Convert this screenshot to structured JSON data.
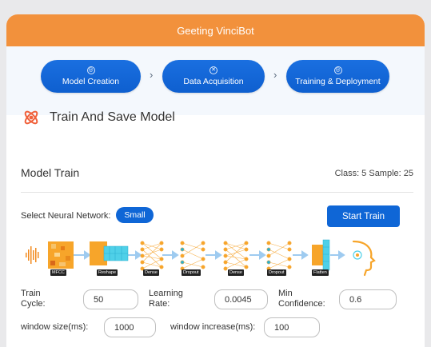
{
  "header": {
    "title": "Geeting VinciBot"
  },
  "steps": [
    {
      "label": "Model Creation"
    },
    {
      "label": "Data Acquisition"
    },
    {
      "label": "Training & Deployment"
    }
  ],
  "section": {
    "title": "Train And Save Model"
  },
  "model_train": {
    "title": "Model Train",
    "class_sample": "Class: 5 Sample: 25",
    "select_label": "Select Neural Network:",
    "network_value": "Small",
    "start_button": "Start Train"
  },
  "pipeline": {
    "layers": [
      "MFCC",
      "Reshape",
      "Dense",
      "Dropout",
      "Dense",
      "Dropout",
      "Flatten"
    ]
  },
  "params": {
    "train_cycle_label_1": "Train",
    "train_cycle_label_2": "Cycle:",
    "train_cycle_value": "50",
    "learning_rate_label_1": "Learning",
    "learning_rate_label_2": "Rate:",
    "learning_rate_value": "0.0045",
    "min_confidence_label_1": "Min",
    "min_confidence_label_2": "Confidence:",
    "min_confidence_value": "0.6",
    "window_size_label": "window size(ms):",
    "window_size_value": "1000",
    "window_increase_label": "window increase(ms):",
    "window_increase_value": "100"
  },
  "colors": {
    "header": "#f2913c",
    "primary": "#0f66d6",
    "accent_icon": "#f0603a"
  }
}
